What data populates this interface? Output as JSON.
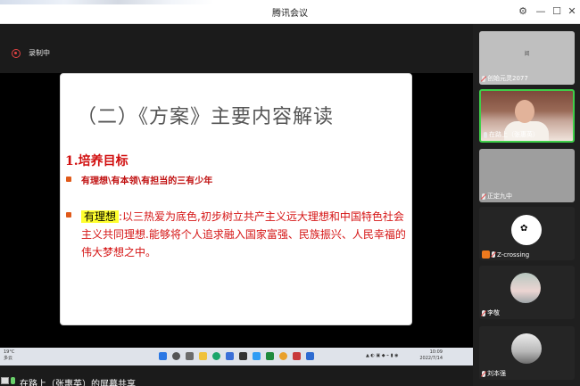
{
  "window": {
    "title": "腾讯会议",
    "controls": {
      "settings_icon": "gear-icon",
      "minimize": "—",
      "maximize": "☐",
      "close": "✕"
    }
  },
  "recording": {
    "label": "录制中"
  },
  "slide": {
    "heading": "（二）《方案》主要内容解读",
    "section": "1.培养目标",
    "bullet1": "有理想\\有本领\\有担当的三有少年",
    "bullet2_highlight": "有理想",
    "bullet2_text": ":以三热爱为底色,初步树立共产主义远大理想和中国特色社会主义共同理想.能够将个人追求融入国家富强、民族振兴、人民幸福的伟大梦想之中。"
  },
  "taskbar": {
    "weather_temp": "19°C",
    "weather_desc": "多云",
    "clock_time": "10:09",
    "clock_date": "2022/7/14"
  },
  "share_bar": {
    "label": "在路上（张惠英）的屏幕共享"
  },
  "participants": [
    {
      "name": "创始元灵2077",
      "muted": true,
      "center_text": "阅"
    },
    {
      "name": "在路上（张惠英）",
      "muted": false,
      "active": true
    },
    {
      "name": "正定九中",
      "muted": true
    },
    {
      "name": "Z-crossing",
      "muted": true,
      "avatar": "logo"
    },
    {
      "name": "李敬",
      "muted": true
    },
    {
      "name": "刘本强",
      "muted": true
    }
  ],
  "colors": {
    "active_speaker": "#3fcf4a",
    "record": "#e54343",
    "slide_red": "#d51414"
  }
}
